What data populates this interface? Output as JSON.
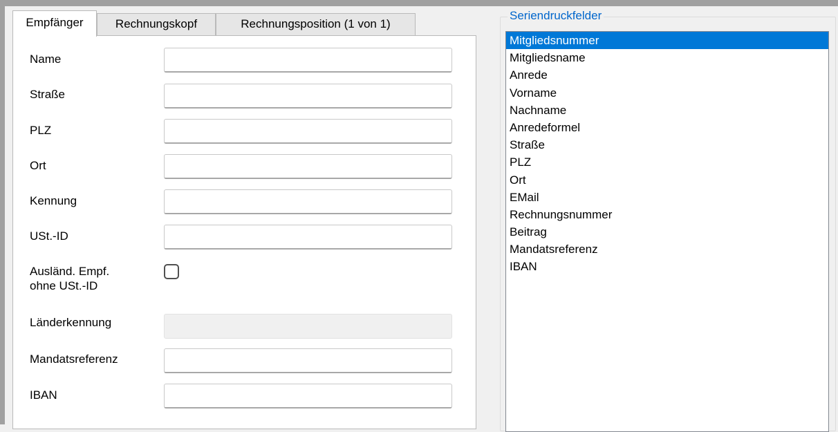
{
  "tabs": [
    {
      "label": "Empfänger",
      "active": true
    },
    {
      "label": "Rechnungskopf",
      "active": false
    },
    {
      "label": "Rechnungsposition (1 von 1)",
      "active": false
    }
  ],
  "form": {
    "name_label": "Name",
    "name_value": "",
    "strasse_label": "Straße",
    "strasse_value": "",
    "plz_label": "PLZ",
    "plz_value": "",
    "ort_label": "Ort",
    "ort_value": "",
    "kennung_label": "Kennung",
    "kennung_value": "",
    "ustid_label": "USt.-ID",
    "ustid_value": "",
    "ausland_label_line1": "Ausländ.  Empf.",
    "ausland_label_line2": "ohne USt.-ID",
    "ausland_checked": false,
    "laenderkennung_label": "Länderkennung",
    "laenderkennung_value": "",
    "mandatsreferenz_label": "Mandatsreferenz",
    "mandatsreferenz_value": "",
    "iban_label": "IBAN",
    "iban_value": ""
  },
  "serienfelder": {
    "title": "Seriendruckfelder",
    "selected": "Mitgliedsnummer",
    "items": [
      "Mitgliedsnummer",
      "Mitgliedsname",
      "Anrede",
      "Vorname",
      "Nachname",
      "Anredeformel",
      "Straße",
      "PLZ",
      "Ort",
      "EMail",
      "Rechnungsnummer",
      "Beitrag",
      "Mandatsreferenz",
      "IBAN"
    ]
  },
  "colors": {
    "selection": "#0078d7",
    "group_title": "#0066cc",
    "window_background": "#f0f0f0"
  }
}
